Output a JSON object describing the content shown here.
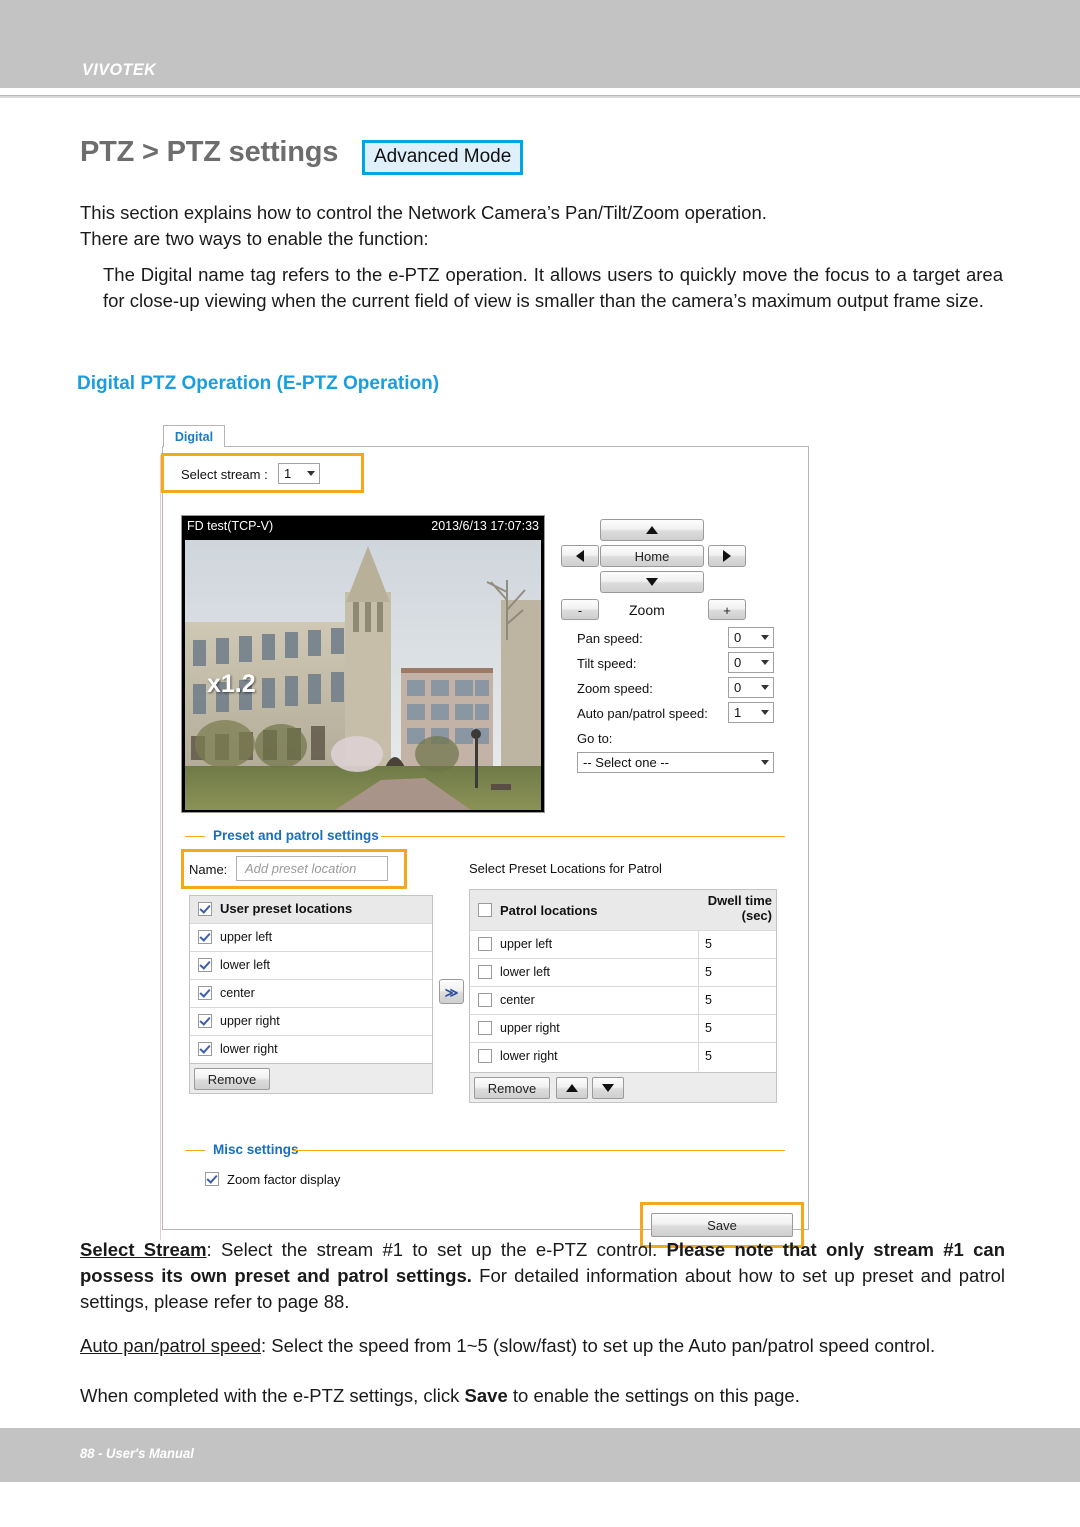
{
  "header": {
    "logo": "VIVOTEK"
  },
  "footer": {
    "text": "88 - User's Manual"
  },
  "page": {
    "title": "PTZ > PTZ settings",
    "mode_badge": "Advanced Mode",
    "intro_line1": "This section explains how to control the Network Camera’s Pan/Tilt/Zoom operation.",
    "intro_line2": "There are two ways to enable the function:",
    "bullet": "The Digital name tag refers to the e-PTZ operation. It allows users to quickly move the focus to a target area for close-up viewing when the current field of view is smaller than the camera’s maximum output frame size.",
    "subheading": "Digital PTZ Operation (E-PTZ Operation)"
  },
  "notes": {
    "select_stream_label": "Select Stream",
    "select_stream_a": ": Select the stream #1 to set up the e-PTZ control. ",
    "select_stream_bold": "Please note that only stream #1 can possess its own preset and patrol settings.",
    "select_stream_b": " For detailed information about how to set up preset and patrol settings, please refer to page 88.",
    "auto_speed_label": "Auto pan/patrol speed",
    "auto_speed_text": ": Select the speed from 1~5 (slow/fast) to set up the Auto pan/patrol speed control.",
    "save_note_a": "When completed with the e-PTZ settings, click ",
    "save_note_bold": "Save",
    "save_note_b": " to enable the settings on this page."
  },
  "ui": {
    "tab": "Digital",
    "select_stream_label": "Select stream :",
    "select_stream_value": "1",
    "video": {
      "title": "FD test(TCP-V)",
      "timestamp": "2013/6/13 17:07:33",
      "zoom_factor": "x1.2"
    },
    "ptz": {
      "home": "Home",
      "zoom_label": "Zoom",
      "zoom_out": "-",
      "zoom_in": "+",
      "up": "▲",
      "down": "▼",
      "left": "◀",
      "right": "▶"
    },
    "speeds": [
      {
        "label": "Pan speed:",
        "value": "0"
      },
      {
        "label": "Tilt speed:",
        "value": "0"
      },
      {
        "label": "Zoom speed:",
        "value": "0"
      },
      {
        "label": "Auto pan/patrol speed:",
        "value": "1"
      }
    ],
    "goto": {
      "label": "Go to:",
      "value": "-- Select one --"
    },
    "preset_section": {
      "legend": "Preset and patrol settings",
      "name_label": "Name:",
      "name_placeholder": "Add preset location",
      "user_list_header": "User preset locations",
      "user_list_header_checked": true,
      "user_locations": [
        {
          "label": "upper left",
          "checked": true
        },
        {
          "label": "lower left",
          "checked": true
        },
        {
          "label": "center",
          "checked": true
        },
        {
          "label": "upper right",
          "checked": true
        },
        {
          "label": "lower right",
          "checked": true
        }
      ],
      "remove_left": "Remove",
      "transfer_button": "≫",
      "patrol_caption": "Select Preset Locations for Patrol",
      "patrol_header": "Patrol locations",
      "patrol_header_checked": false,
      "dwell_header_l1": "Dwell time",
      "dwell_header_l2": "(sec)",
      "patrol_locations": [
        {
          "label": "upper left",
          "checked": false,
          "dwell": "5"
        },
        {
          "label": "lower left",
          "checked": false,
          "dwell": "5"
        },
        {
          "label": "center",
          "checked": false,
          "dwell": "5"
        },
        {
          "label": "upper right",
          "checked": false,
          "dwell": "5"
        },
        {
          "label": "lower right",
          "checked": false,
          "dwell": "5"
        }
      ],
      "remove_right": "Remove",
      "move_up": "▲",
      "move_down": "▼"
    },
    "misc_section": {
      "legend": "Misc settings",
      "zoom_factor_display": "Zoom factor display",
      "zoom_factor_checked": true
    },
    "save_button": "Save"
  }
}
